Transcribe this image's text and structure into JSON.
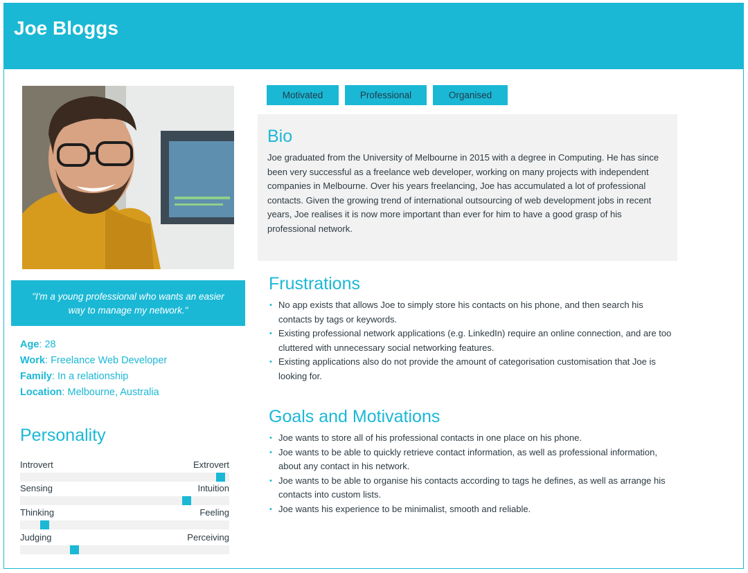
{
  "header": {
    "name": "Joe Bloggs"
  },
  "quote": "\"I'm a young professional who wants an easier way to manage my network.\"",
  "facts": [
    {
      "key": "Age",
      "value": "28"
    },
    {
      "key": "Work",
      "value": "Freelance Web Developer"
    },
    {
      "key": "Family",
      "value": "In a relationship"
    },
    {
      "key": "Location",
      "value": "Melbourne, Australia"
    }
  ],
  "personality": {
    "title": "Personality",
    "traits": [
      {
        "left": "Introvert",
        "right": "Extrovert",
        "level": 0.98
      },
      {
        "left": "Sensing",
        "right": "Intuition",
        "level": 0.81
      },
      {
        "left": "Thinking",
        "right": "Feeling",
        "level": 0.1
      },
      {
        "left": "Judging",
        "right": "Perceiving",
        "level": 0.25
      }
    ]
  },
  "tags": [
    "Motivated",
    "Professional",
    "Organised"
  ],
  "bio": {
    "title": "Bio",
    "text": "Joe graduated from the University of Melbourne in 2015 with a degree in Computing. He has since been very successful as a freelance web developer, working on many projects with independent companies in Melbourne. Over his years freelancing, Joe has accumulated a lot of professional contacts. Given the growing trend of international outsourcing of web development jobs in recent years, Joe realises it is now more important than ever for him to have a good grasp of his professional network."
  },
  "frustrations": {
    "title": "Frustrations",
    "items": [
      "No app exists that allows Joe to simply store his contacts on his phone, and then search his contacts by tags or keywords.",
      "Existing professional network applications (e.g. LinkedIn) require an online connection, and are too cluttered with unnecessary social networking features.",
      "Existing applications also do not provide the amount of categorisation customisation that Joe is looking for."
    ]
  },
  "goals": {
    "title": "Goals and Motivations",
    "items": [
      "Joe wants to store all of his professional contacts in one place on his phone.",
      "Joe wants to be able to quickly retrieve contact information, as well as professional information, about any contact in his network.",
      "Joe wants to be able to organise his contacts according to tags he defines, as well as arrange his contacts into custom lists.",
      "Joe wants his experience to be minimalist, smooth and reliable."
    ]
  },
  "colors": {
    "accent": "#1bb8d5",
    "panel": "#f2f2f2",
    "text": "#2b3a42"
  }
}
